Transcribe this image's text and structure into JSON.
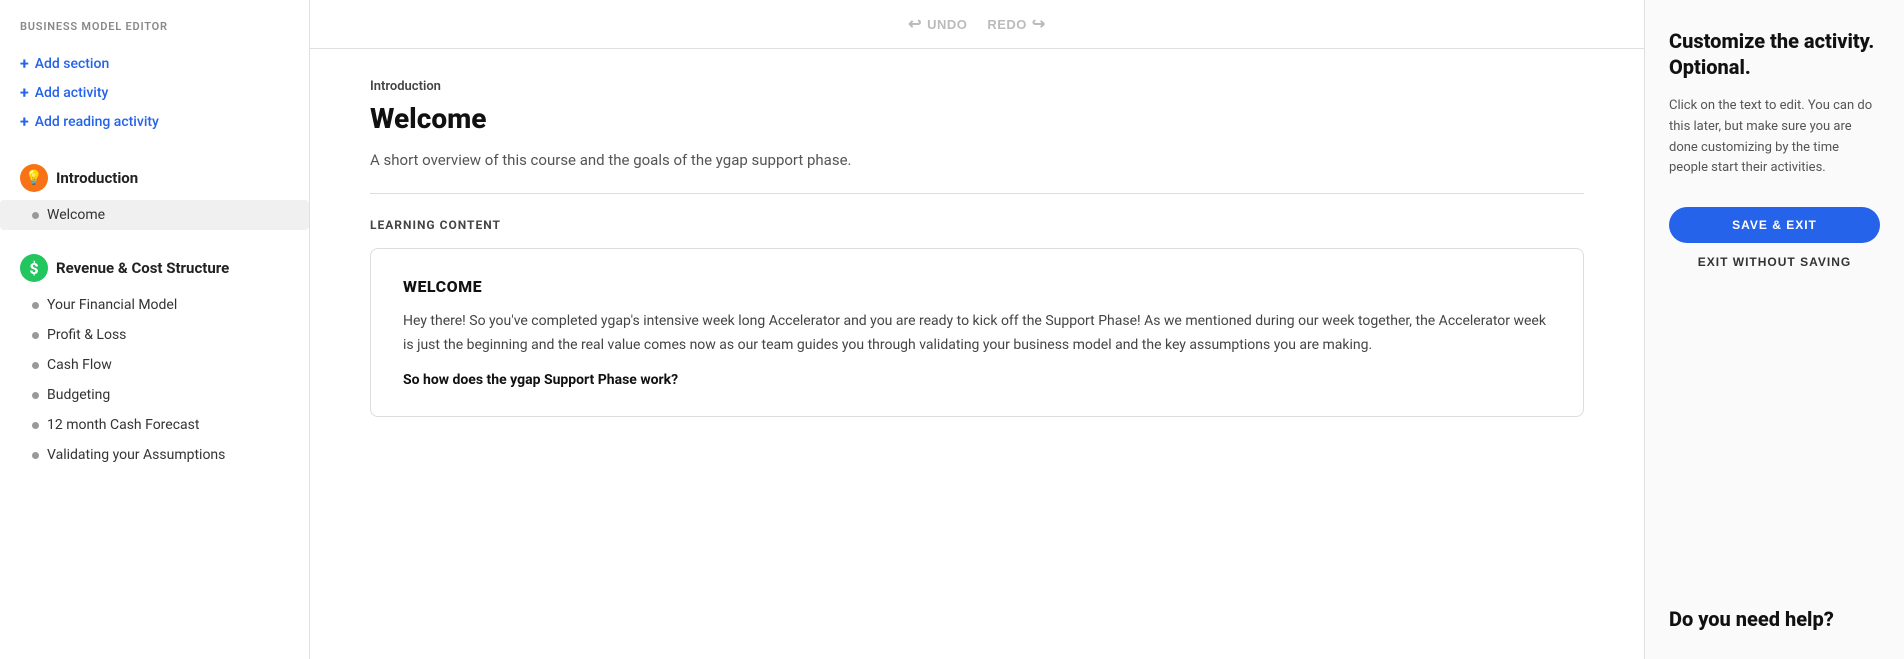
{
  "sidebar": {
    "header": "BUSINESS MODEL EDITOR",
    "actions": [
      {
        "label": "Add section",
        "id": "add-section"
      },
      {
        "label": "Add activity",
        "id": "add-activity"
      },
      {
        "label": "Add reading activity",
        "id": "add-reading-activity"
      }
    ],
    "sections": [
      {
        "id": "introduction",
        "label": "Introduction",
        "icon": "💡",
        "icon_class": "icon-orange",
        "items": [
          {
            "label": "Welcome",
            "active": true
          }
        ]
      },
      {
        "id": "revenue-cost",
        "label": "Revenue & Cost Structure",
        "icon": "$",
        "icon_class": "icon-green",
        "items": [
          {
            "label": "Your Financial Model",
            "active": false
          },
          {
            "label": "Profit & Loss",
            "active": false
          },
          {
            "label": "Cash Flow",
            "active": false
          },
          {
            "label": "Budgeting",
            "active": false
          },
          {
            "label": "12 month Cash Forecast",
            "active": false
          },
          {
            "label": "Validating your Assumptions",
            "active": false
          }
        ]
      }
    ]
  },
  "toolbar": {
    "undo_label": "UNDO",
    "redo_label": "REDO"
  },
  "main": {
    "intro_label": "Introduction",
    "page_title": "Welcome",
    "description": "A short overview of this course and the goals of the ygap support phase.",
    "learning_content_label": "LEARNING CONTENT",
    "card": {
      "title": "WELCOME",
      "body1": "Hey there! So you've completed ygap's intensive week long Accelerator and you are ready to kick off the Support Phase! As we mentioned during our week together, the Accelerator week is just the beginning and the real value comes now as our team guides you through validating your business model and the key assumptions you are making.",
      "subheading": "So how does the ygap Support Phase work?"
    }
  },
  "right_panel": {
    "title": "Customize the activity. Optional.",
    "description": "Click on the text to edit. You can do this later, but make sure you are done customizing by the time people start their activities.",
    "save_exit_label": "SAVE & EXIT",
    "exit_no_save_label": "EXIT WITHOUT SAVING",
    "help_title": "Do you need help?"
  }
}
